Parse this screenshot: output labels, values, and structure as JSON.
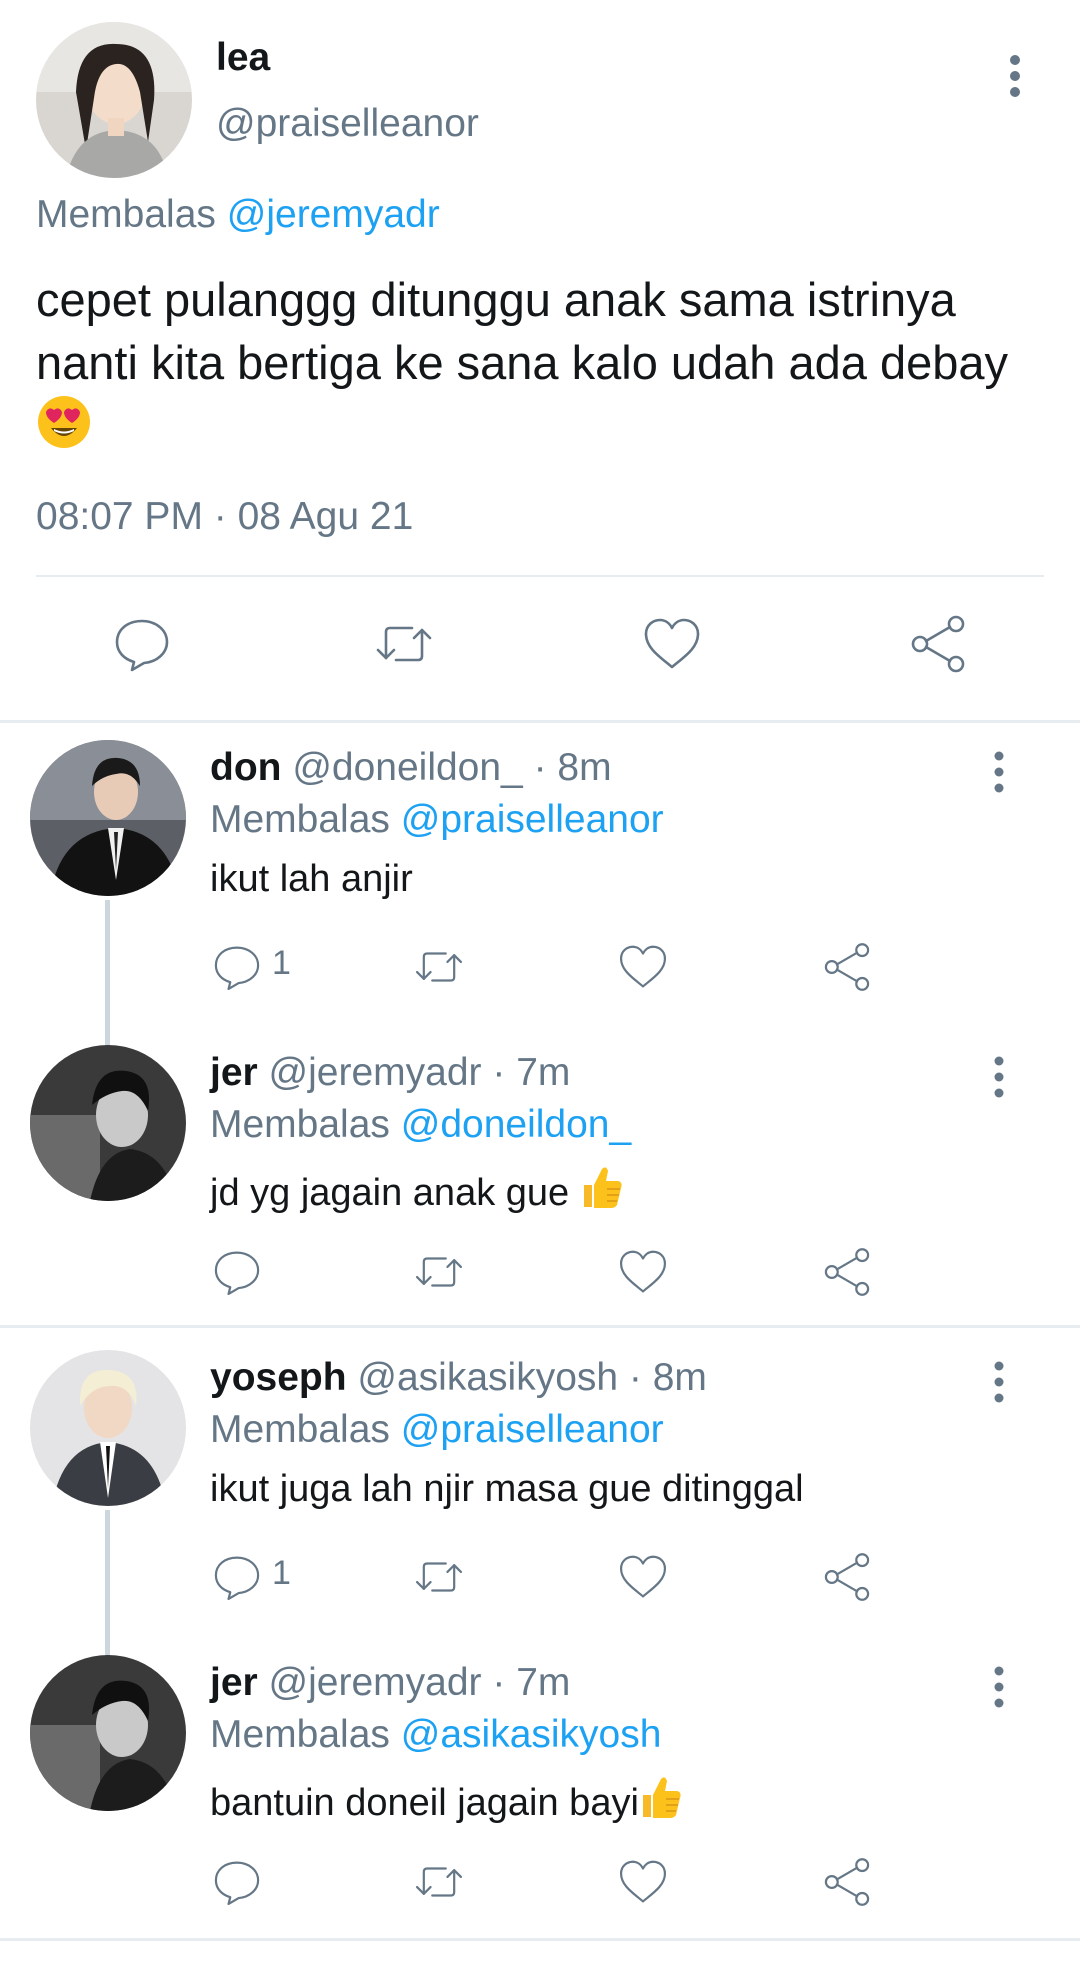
{
  "main_tweet": {
    "name": "lea",
    "handle": "@praiselleanor",
    "reply_prefix": "Membalas",
    "reply_to": "@jeremyadr",
    "text": "cepet pulanggg ditunggu anak sama istrinya nanti kita bertiga ke sana kalo udah ada debay",
    "emoji": "heart-eyes-emoji",
    "timestamp": "08:07 PM · 08 Agu 21"
  },
  "replies": [
    {
      "name": "don",
      "handle": "@doneildon_",
      "time": "· 8m",
      "reply_prefix": "Membalas",
      "reply_to": "@praiselleanor",
      "text": "ikut lah anjir",
      "reply_count": "1"
    },
    {
      "name": "jer",
      "handle": "@jeremyadr",
      "time": "· 7m",
      "reply_prefix": "Membalas",
      "reply_to": "@doneildon_",
      "text": "jd yg jagain anak gue ",
      "emoji": "thumbs-up-emoji"
    },
    {
      "name": "yoseph",
      "handle": "@asikasikyosh",
      "time": "· 8m",
      "reply_prefix": "Membalas",
      "reply_to": "@praiselleanor",
      "text": "ikut juga lah njir masa gue ditinggal",
      "reply_count": "1"
    },
    {
      "name": "jer",
      "handle": "@jeremyadr",
      "time": "· 7m",
      "reply_prefix": "Membalas",
      "reply_to": "@asikasikyosh",
      "text": "bantuin doneil jagain bayi",
      "emoji": "thumbs-up-emoji"
    }
  ],
  "colors": {
    "accent": "#1da1f2",
    "secondary_text": "#657786",
    "primary_text": "#14171a",
    "divider": "#e6ecf0"
  }
}
